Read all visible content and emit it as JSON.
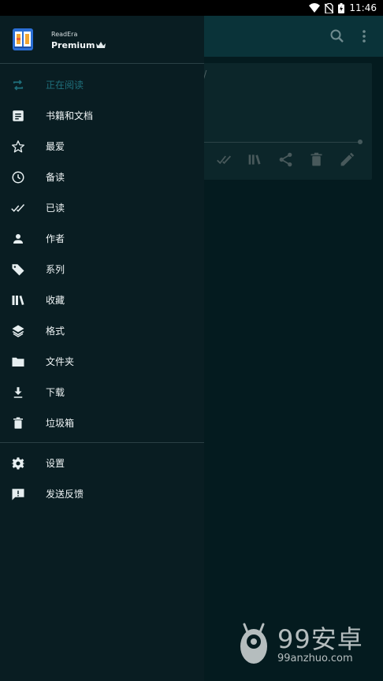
{
  "status_bar": {
    "time": "11:46"
  },
  "drawer": {
    "brand": "ReadEra",
    "tier": "Premium",
    "menu": [
      {
        "label": "正在阅读",
        "icon": "repeat-icon",
        "active": true
      },
      {
        "label": "书籍和文档",
        "icon": "document-icon"
      },
      {
        "label": "最爱",
        "icon": "star-icon"
      },
      {
        "label": "备读",
        "icon": "clock-icon"
      },
      {
        "label": "已读",
        "icon": "double-check-icon"
      },
      {
        "label": "作者",
        "icon": "person-icon"
      },
      {
        "label": "系列",
        "icon": "tag-icon"
      },
      {
        "label": "收藏",
        "icon": "books-icon"
      },
      {
        "label": "格式",
        "icon": "layers-icon"
      },
      {
        "label": "文件夹",
        "icon": "folder-icon"
      },
      {
        "label": "下载",
        "icon": "download-icon"
      },
      {
        "label": "垃圾箱",
        "icon": "trash-icon"
      }
    ],
    "footer_menu": [
      {
        "label": "设置",
        "icon": "gear-icon"
      },
      {
        "label": "发送反馈",
        "icon": "feedback-icon"
      }
    ]
  },
  "background": {
    "card_text": "/"
  },
  "watermark": {
    "big": "99安卓",
    "small": "99anzhuo.com"
  },
  "colors": {
    "drawer_bg": "#091d22",
    "appbar_bg": "#0a3339",
    "active": "#1f6f7b"
  }
}
